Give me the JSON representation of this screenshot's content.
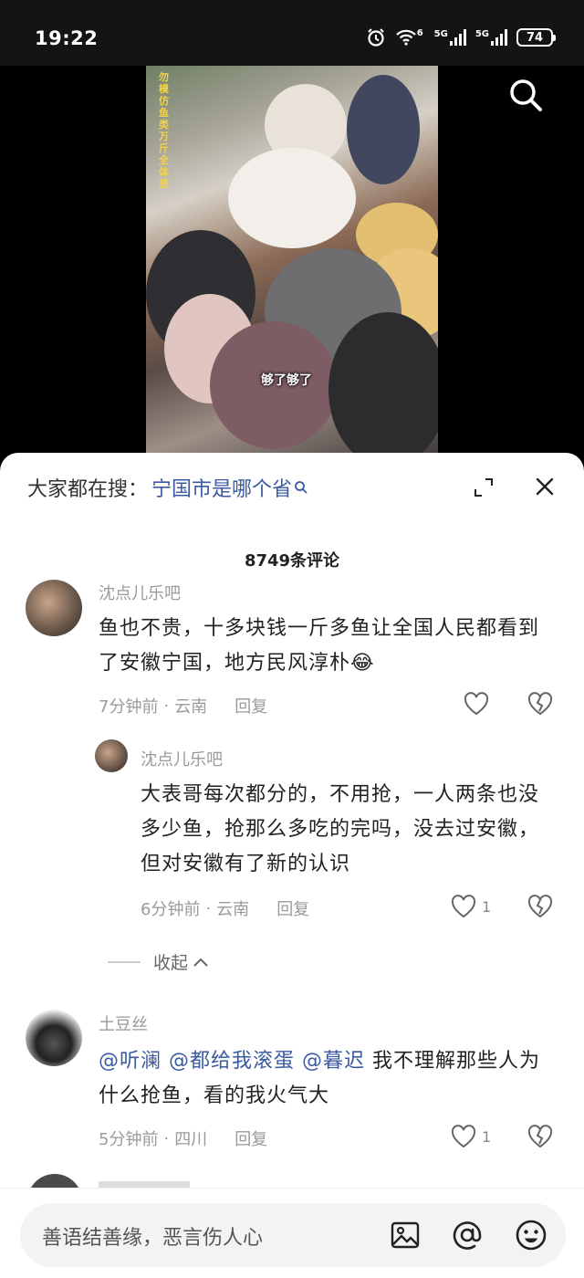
{
  "status_bar": {
    "time": "19:22",
    "net1": "5G",
    "net2": "5G",
    "wifi_sub": "6",
    "battery": "74",
    "icons": [
      "alarm-icon",
      "wifi-icon",
      "signal-icon",
      "signal-icon",
      "battery-icon"
    ]
  },
  "video": {
    "caption": "够了够了",
    "vertical_text": "勿模仿 鱼类万斤 全体员",
    "search_icon": "search-icon"
  },
  "trending": {
    "prefix": "大家都在搜：",
    "query": "宁国市是哪个省"
  },
  "comment_count": "8749条评论",
  "comments": [
    {
      "username": "沈点儿乐吧",
      "text": "鱼也不贵，十多块钱一斤多鱼让全国人民都看到了安徽宁国，地方民风淳朴😂",
      "time": "7分钟前",
      "location": "云南",
      "reply_label": "回复",
      "likes": ""
    },
    {
      "username": "沈点儿乐吧",
      "text": "大表哥每次都分的，不用抢，一人两条也没多少鱼，抢那么多吃的完吗，没去过安徽，但对安徽有了新的认识",
      "time": "6分钟前",
      "location": "云南",
      "reply_label": "回复",
      "likes": "1"
    },
    {
      "username": "土豆丝",
      "mentions": [
        "@听澜",
        "@都给我滚蛋",
        "@暮迟"
      ],
      "text": "我不理解那些人为什么抢鱼，看的我火气大",
      "time": "5分钟前",
      "location": "四川",
      "reply_label": "回复",
      "likes": "1"
    }
  ],
  "collapse_label": "收起",
  "meta_separator": "·",
  "input": {
    "placeholder": "善语结善缘，恶言伤人心"
  },
  "colors": {
    "link": "#3b5aa0",
    "muted": "#9a9a9a",
    "text": "#222222"
  }
}
